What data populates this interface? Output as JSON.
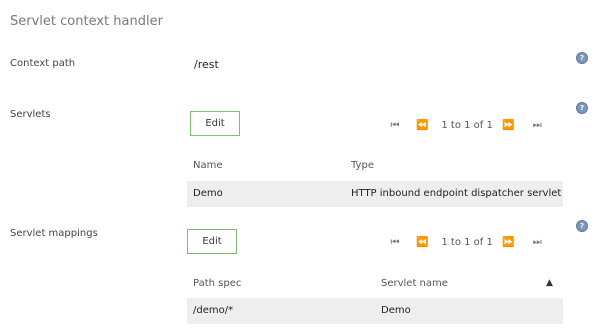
{
  "section_title": "Servlet context handler",
  "context_path": {
    "label": "Context path",
    "value": "/rest"
  },
  "servlets": {
    "label": "Servlets",
    "edit_label": "Edit",
    "pager": {
      "first": "⏮",
      "prev": "⏪",
      "info": "1 to 1 of 1",
      "next": "⏩",
      "last": "⏭"
    },
    "columns": [
      "Name",
      "Type"
    ],
    "rows": [
      {
        "name": "Demo",
        "type": "HTTP inbound endpoint dispatcher servlet"
      }
    ]
  },
  "servlet_mappings": {
    "label": "Servlet mappings",
    "edit_label": "Edit",
    "pager": {
      "first": "⏮",
      "prev": "⏪",
      "info": "1 to 1 of 1",
      "next": "⏩",
      "last": "⏭"
    },
    "columns": [
      "Path spec",
      "Servlet name"
    ],
    "sort_indicator": "▲",
    "rows": [
      {
        "path": "/demo/*",
        "servlet": "Demo"
      }
    ]
  },
  "help_glyph": "?",
  "colors": {
    "button_border": "#7cc06e",
    "row_background": "#eeeeee",
    "help_icon": "#7f95b8"
  }
}
